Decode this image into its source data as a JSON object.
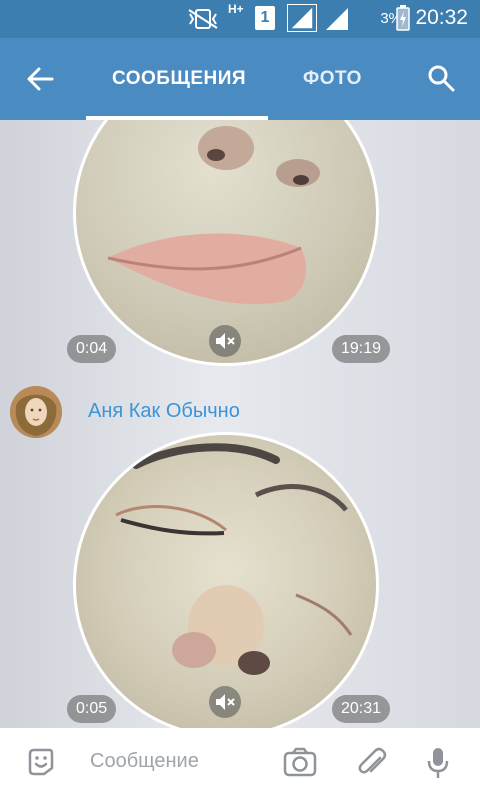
{
  "status_bar": {
    "network": "H+",
    "sim": "1",
    "battery_percent": "3%",
    "time": "20:32"
  },
  "header": {
    "tabs": [
      {
        "label": "СООБЩЕНИЯ",
        "active": true
      },
      {
        "label": "ФОТО",
        "active": false
      }
    ],
    "accent_color": "#4a8bc2"
  },
  "messages": [
    {
      "type": "video-note",
      "duration": "0:04",
      "time": "19:19",
      "muted": true
    },
    {
      "type": "sender",
      "name": "Аня Как Обычно"
    },
    {
      "type": "video-note",
      "duration": "0:05",
      "time": "20:31",
      "muted": true
    }
  ],
  "composer": {
    "placeholder": "Сообщение"
  },
  "icons": [
    "back-arrow-icon",
    "search-icon",
    "sticker-icon",
    "camera-icon",
    "attach-icon",
    "mic-icon",
    "mute-icon"
  ]
}
